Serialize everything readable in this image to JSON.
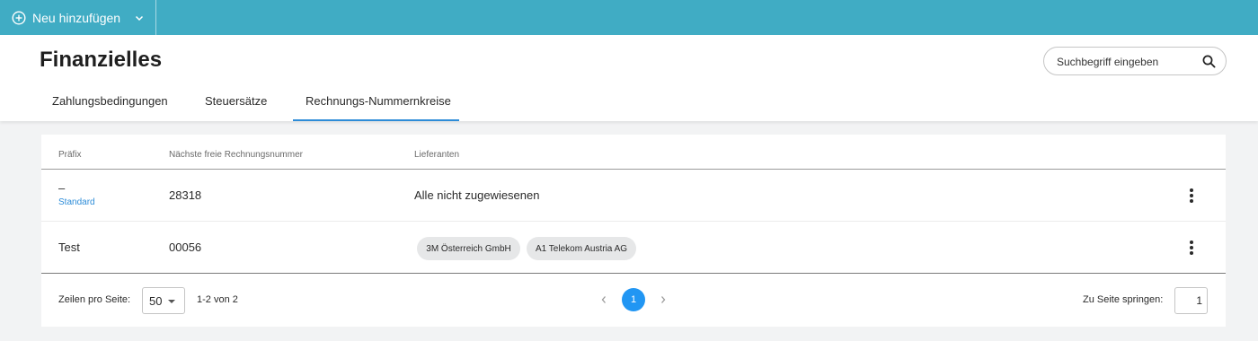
{
  "topbar": {
    "add_label": "Neu hinzufügen",
    "color": "#40acc4"
  },
  "page": {
    "title": "Finanzielles"
  },
  "search": {
    "placeholder": "Suchbegriff eingeben",
    "value": ""
  },
  "tabs": [
    {
      "label": "Zahlungsbedingungen",
      "active": false
    },
    {
      "label": "Steuersätze",
      "active": false
    },
    {
      "label": "Rechnungs-Nummernkreise",
      "active": true
    }
  ],
  "table": {
    "columns": [
      "Präfix",
      "Nächste freie Rechnungsnummer",
      "Lieferanten"
    ],
    "rows": [
      {
        "prefix": "–",
        "prefix_badge": "Standard",
        "next_number": "28318",
        "suppliers_text": "Alle nicht zugewiesenen",
        "suppliers": []
      },
      {
        "prefix": "Test",
        "next_number": "00056",
        "suppliers": [
          "3M Österreich GmbH",
          "A1 Telekom Austria AG"
        ]
      }
    ]
  },
  "pagination": {
    "rows_per_page_label": "Zeilen pro Seite:",
    "rows_per_page": "50",
    "range_text": "1-2 von 2",
    "current_page": "1",
    "jump_label": "Zu Seite springen:",
    "jump_value": "1"
  },
  "colors": {
    "accent": "#2196f3",
    "link": "#2d8cd8"
  },
  "icons": {
    "add": "plus-circle-icon",
    "dropdown": "chevron-down-icon",
    "search": "search-icon",
    "row_menu": "more-vertical-icon",
    "prev": "chevron-left-icon",
    "next": "chevron-right-icon"
  }
}
